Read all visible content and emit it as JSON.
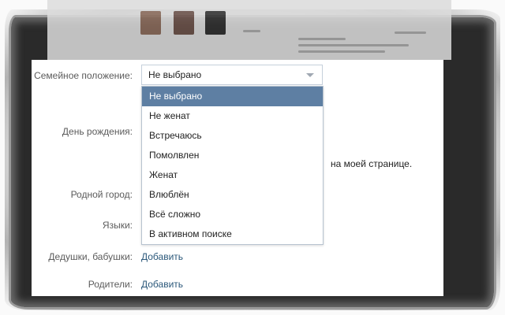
{
  "form": {
    "marital_label": "Семейное положение:",
    "birthday_label": "День рождения:",
    "hometown_label": "Родной город:",
    "languages_label": "Языки:",
    "grandparents_label": "Дедушки, бабушки:",
    "parents_label": "Родители:",
    "grandparents_add": "Добавить",
    "parents_add": "Добавить",
    "birthday_visibility_note": "на моей странице."
  },
  "marital_select": {
    "value": "Не выбрано",
    "options": [
      "Не выбрано",
      "Не женат",
      "Встречаюсь",
      "Помолвлен",
      "Женат",
      "Влюблён",
      "Всё сложно",
      "В активном поиске"
    ],
    "highlighted_index": 0
  },
  "colors": {
    "link": "#2b587a",
    "highlight": "#5e7fa3",
    "label": "#5b5b5b"
  }
}
